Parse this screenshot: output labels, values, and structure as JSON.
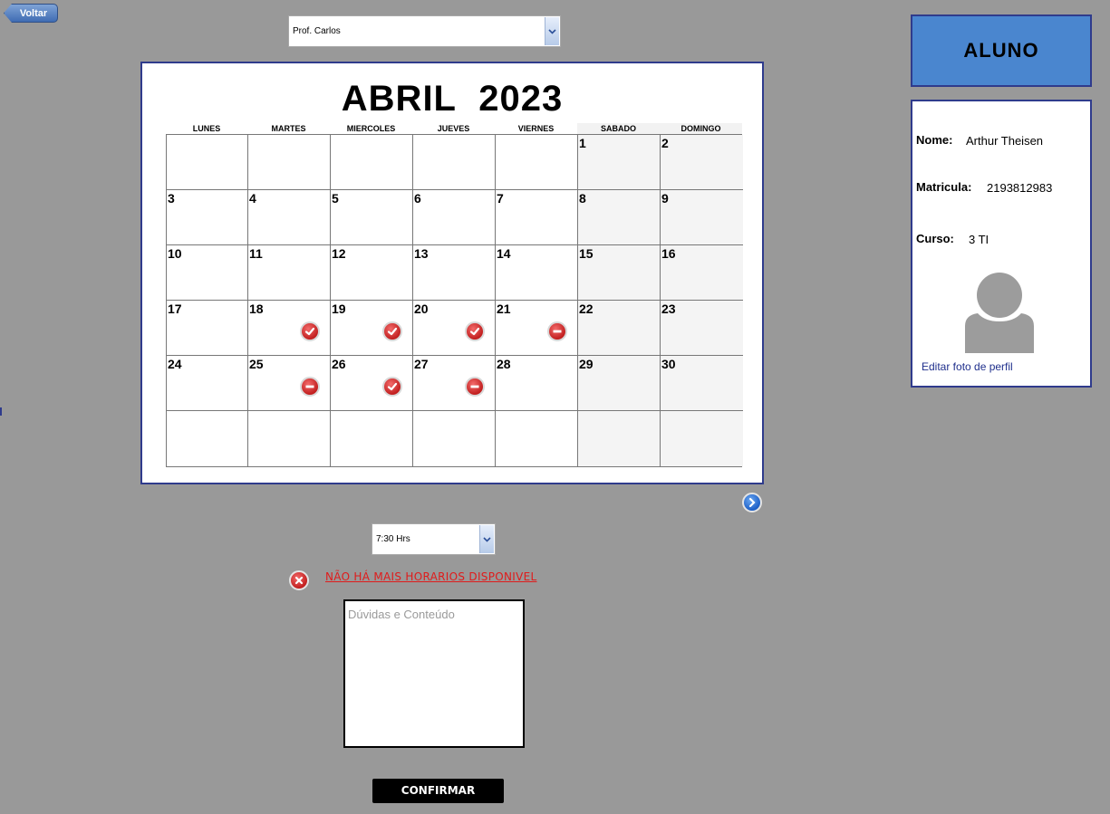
{
  "nav": {
    "back_label": "Voltar"
  },
  "teacher_select": {
    "value": "Prof. Carlos"
  },
  "calendar": {
    "month": "ABRIL",
    "year": "2023",
    "weekdays": [
      "LUNES",
      "MARTES",
      "MIERCOLES",
      "JUEVES",
      "VIERNES",
      "SABADO",
      "DOMINGO"
    ],
    "weeks": [
      [
        "",
        "",
        "",
        "",
        "",
        "1",
        "2"
      ],
      [
        "3",
        "4",
        "5",
        "6",
        "7",
        "8",
        "9"
      ],
      [
        "10",
        "11",
        "12",
        "13",
        "14",
        "15",
        "16"
      ],
      [
        "17",
        "18",
        "19",
        "20",
        "21",
        "22",
        "23"
      ],
      [
        "24",
        "25",
        "26",
        "27",
        "28",
        "29",
        "30"
      ],
      [
        "",
        "",
        "",
        "",
        "",
        "",
        ""
      ]
    ],
    "marks": [
      {
        "day": "18",
        "status": "available"
      },
      {
        "day": "19",
        "status": "available"
      },
      {
        "day": "20",
        "status": "available"
      },
      {
        "day": "21",
        "status": "unavailable"
      },
      {
        "day": "25",
        "status": "unavailable"
      },
      {
        "day": "26",
        "status": "available"
      },
      {
        "day": "27",
        "status": "unavailable"
      }
    ]
  },
  "time_select": {
    "value": "7:30 Hrs"
  },
  "error": {
    "message": "NÃO HÁ MAIS HORARIOS DISPONIVEL"
  },
  "notes": {
    "placeholder": "Dúvidas e Conteúdo"
  },
  "confirm": {
    "label": "CONFIRMAR"
  },
  "profile": {
    "header": "ALUNO",
    "name_label": "Nome:",
    "name": "Arthur Theisen",
    "matricula_label": "Matricula:",
    "matricula": "2193812983",
    "curso_label": "Curso:",
    "curso": "3 TI",
    "edit_photo_label": "Editar foto de perfil"
  },
  "colors": {
    "background": "#999999",
    "accent_blue": "#4a86cf",
    "border_navy": "#2f3b8c",
    "error_red": "#e01b1b"
  },
  "icons": {
    "available": "check-circle-icon",
    "unavailable": "minus-circle-icon",
    "next": "chevron-right-circle-icon",
    "error": "x-circle-icon"
  }
}
